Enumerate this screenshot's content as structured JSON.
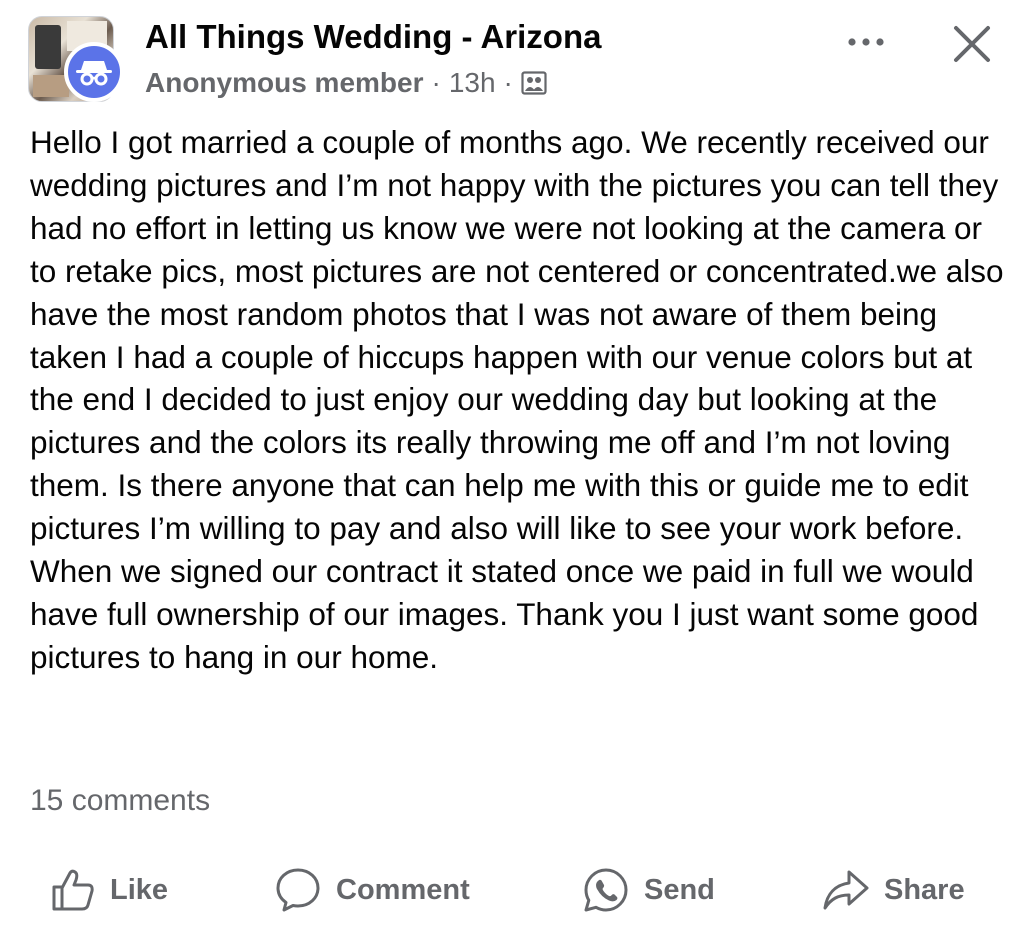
{
  "post": {
    "group_name": "All Things Wedding - Arizona",
    "author": "Anonymous member",
    "separator": "·",
    "time": "13h",
    "audience_icon": "group-members-icon",
    "body": "Hello I got married a couple of months ago. We recently received our wedding pictures and I’m not happy with the pictures you can tell they had no effort in letting us know we were not looking at the camera or to retake pics, most pictures are not centered or concentrated.we also have the most random photos that I was not aware of them being taken I had a couple of hiccups happen with our venue colors but at the end I decided to just enjoy our wedding day but looking at the pictures and the colors its really throwing me off and I’m not loving them. Is there anyone that can help me with this or guide me to edit pictures I’m willing to pay and also will like to see your work before. When we signed our contract it stated once we paid in full we would have full ownership of our images. Thank you I just want some good pictures to hang in our home.",
    "comments_count": "15 comments"
  },
  "header": {
    "more_icon": "more-horizontal-icon",
    "close_icon": "close-icon"
  },
  "actions": {
    "like": "Like",
    "comment": "Comment",
    "send": "Send",
    "share": "Share"
  },
  "colors": {
    "text": "#050505",
    "secondary": "#65676b",
    "anon_badge": "#5b73e8",
    "background": "#ffffff"
  }
}
